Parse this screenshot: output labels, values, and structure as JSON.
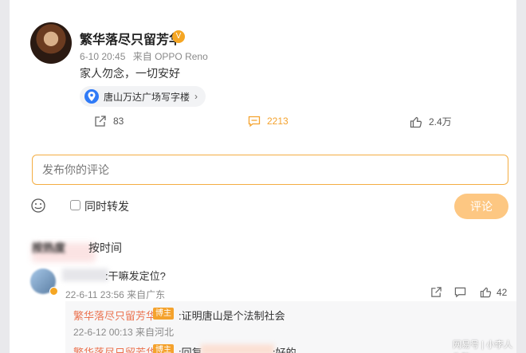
{
  "post": {
    "username": "繁华落尽只留芳华",
    "vip_badge": "VIP",
    "date": "6-10 20:45",
    "source": "来自 OPPO Reno",
    "text": "家人勿念，一切安好",
    "location": "唐山万达广场写字楼",
    "reposts": "83",
    "comments": "2213",
    "likes": "2.4万"
  },
  "composer": {
    "placeholder": "发布你的评论",
    "repost_label": "同时转发",
    "submit_label": "评论"
  },
  "sort": {
    "hot": "按热度",
    "time": "按时间"
  },
  "comment": {
    "text": ":干嘛发定位?",
    "meta": "22-6-11 23:56 来自广东",
    "likes": "42"
  },
  "replies": [
    {
      "name": "繁华落尽只留芳华",
      "badge": "博主",
      "text": ":证明唐山是个法制社会",
      "meta": "22-6-12 00:13 来自河北"
    },
    {
      "name": "繁华落尽只留芳华",
      "badge": "博主",
      "text": ":回复",
      "tail": ":好的"
    }
  ],
  "watermark": "网易号 | 小李人生路",
  "colors": {
    "accent": "#f4a22d",
    "link": "#eb7350",
    "button": "#fdc782",
    "location_icon": "#2f7af7"
  }
}
